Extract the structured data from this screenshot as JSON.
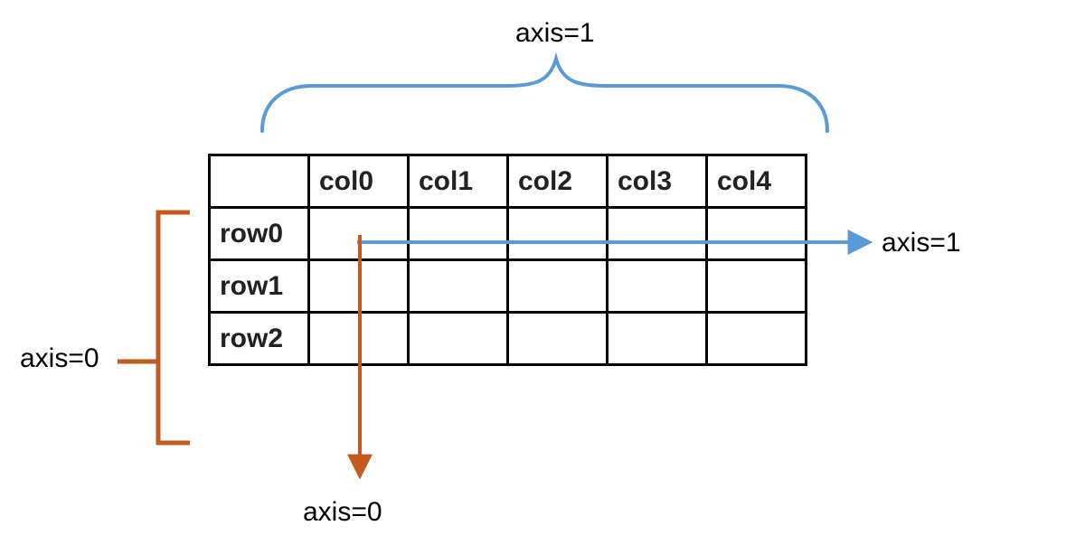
{
  "labels": {
    "axis1_top": "axis=1",
    "axis1_right": "axis=1",
    "axis0_left": "axis=0",
    "axis0_bottom": "axis=0"
  },
  "table": {
    "columns": [
      "col0",
      "col1",
      "col2",
      "col3",
      "col4"
    ],
    "rows": [
      "row0",
      "row1",
      "row2"
    ]
  },
  "colors": {
    "blue": "#5b9bd5",
    "orange": "#c55a1e"
  }
}
